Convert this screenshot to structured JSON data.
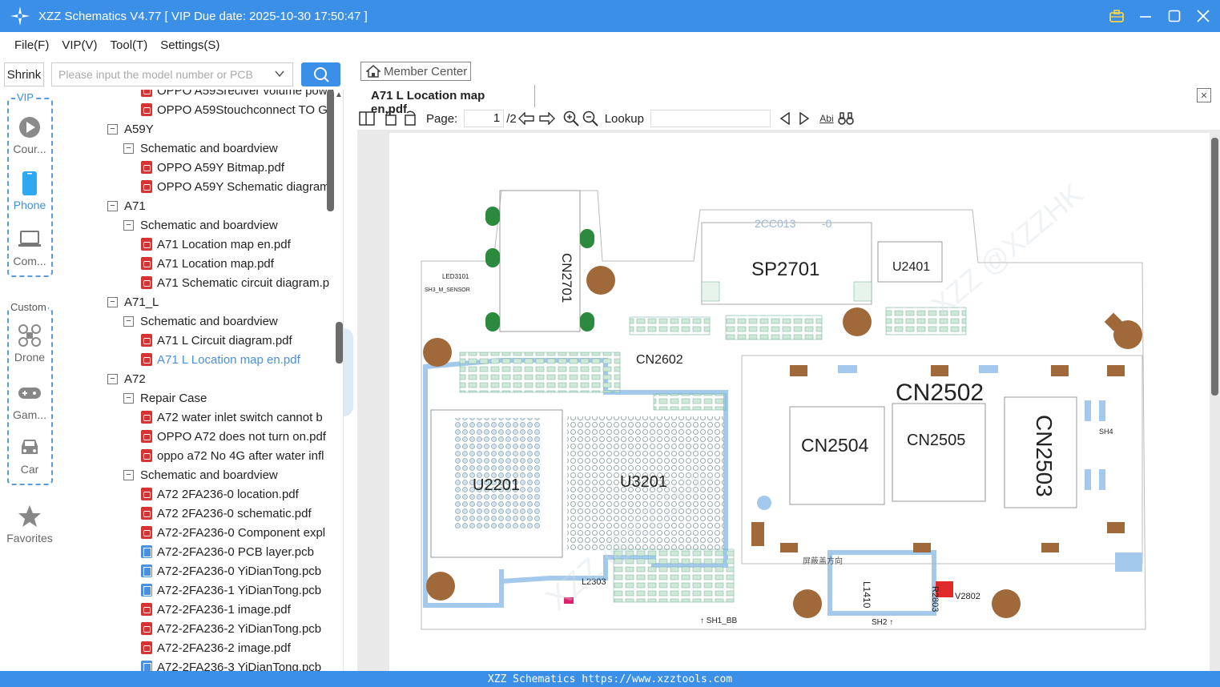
{
  "app": {
    "title": "XZZ Schematics V4.77 [ VIP Due date: 2025-10-30 17:50:47 ]"
  },
  "menu": [
    "File(F)",
    "VIP(V)",
    "Tool(T)",
    "Settings(S)"
  ],
  "search": {
    "shrink_label": "Shrink",
    "placeholder": "Please input the model number or PCB"
  },
  "categories": {
    "vip_label": "VIP",
    "custom_label": "Custom",
    "vip": [
      "Cour...",
      "Phone",
      "Com..."
    ],
    "custom": [
      "Drone",
      "Gam...",
      "Car"
    ],
    "favorites": "Favorites"
  },
  "tree": [
    {
      "level": 3,
      "icon": "pdf",
      "label": "OPPO A59Sreciver volume powe"
    },
    {
      "level": 3,
      "icon": "pdf",
      "label": "OPPO A59Stouchconnect TO GI"
    },
    {
      "level": 1,
      "icon": "box",
      "label": "A59Y"
    },
    {
      "level": 2,
      "icon": "box",
      "label": "Schematic and boardview"
    },
    {
      "level": 3,
      "icon": "pdf",
      "label": "OPPO A59Y Bitmap.pdf"
    },
    {
      "level": 3,
      "icon": "pdf",
      "label": "OPPO A59Y Schematic diagram"
    },
    {
      "level": 1,
      "icon": "box",
      "label": "A71"
    },
    {
      "level": 2,
      "icon": "box",
      "label": "Schematic and boardview"
    },
    {
      "level": 3,
      "icon": "pdf",
      "label": "A71 Location map en.pdf"
    },
    {
      "level": 3,
      "icon": "pdf",
      "label": "A71 Location map.pdf"
    },
    {
      "level": 3,
      "icon": "pdf",
      "label": "A71 Schematic circuit diagram.p"
    },
    {
      "level": 1,
      "icon": "box",
      "label": "A71_L"
    },
    {
      "level": 2,
      "icon": "box",
      "label": "Schematic and boardview"
    },
    {
      "level": 3,
      "icon": "pdf",
      "label": "A71 L Circuit diagram.pdf"
    },
    {
      "level": 3,
      "icon": "pdf",
      "label": "A71 L Location map en.pdf",
      "selected": true
    },
    {
      "level": 1,
      "icon": "box",
      "label": "A72"
    },
    {
      "level": 2,
      "icon": "box",
      "label": "Repair Case"
    },
    {
      "level": 3,
      "icon": "pdf",
      "label": "A72 water inlet switch cannot b"
    },
    {
      "level": 3,
      "icon": "pdf",
      "label": "OPPO A72 does not turn on.pdf"
    },
    {
      "level": 3,
      "icon": "pdf",
      "label": "oppo a72 No 4G after water infl"
    },
    {
      "level": 2,
      "icon": "box",
      "label": "Schematic and boardview"
    },
    {
      "level": 3,
      "icon": "pdf",
      "label": "A72 2FA236-0 location.pdf"
    },
    {
      "level": 3,
      "icon": "pdf",
      "label": "A72 2FA236-0 schematic.pdf"
    },
    {
      "level": 3,
      "icon": "pdf",
      "label": "A72-2FA236-0 Component expl"
    },
    {
      "level": 3,
      "icon": "pcb",
      "label": "A72-2FA236-0 PCB layer.pcb"
    },
    {
      "level": 3,
      "icon": "pcb",
      "label": "A72-2FA236-0 YiDianTong.pcb"
    },
    {
      "level": 3,
      "icon": "pcb",
      "label": "A72-2FA236-1 YiDianTong.pcb"
    },
    {
      "level": 3,
      "icon": "pdf",
      "label": "A72-2FA236-1 image.pdf"
    },
    {
      "level": 3,
      "icon": "pdf",
      "label": "A72-2FA236-2 YiDianTong.pcb"
    },
    {
      "level": 3,
      "icon": "pdf",
      "label": "A72-2FA236-2 image.pdf"
    },
    {
      "level": 3,
      "icon": "pcb",
      "label": "A72-2FA236-3 YiDianTong.pcb"
    }
  ],
  "viewer": {
    "member_center": "Member Center",
    "tab_title": "A71 L Location map en.pdf",
    "page_label": "Page:",
    "page_current": "1",
    "page_total": "/2",
    "lookup_label": "Lookup"
  },
  "board": {
    "labels": [
      "CN2701",
      "SP2701",
      "U2401",
      "2CC013",
      "-0",
      "CN2602",
      "CN2502",
      "CN2504",
      "CN2505",
      "CN2503",
      "U2201",
      "U3201",
      "L2303",
      "L1410",
      "R2803",
      "V2802",
      "SH1_BB",
      "SH2",
      "SH4",
      "LED3101",
      "SH3_M_SENSOR",
      "屏蔽盖方向"
    ],
    "watermark": "XZZ @XZZHK"
  },
  "status": {
    "text": "XZZ Schematics https://www.xzztools.com"
  },
  "colors": {
    "accent": "#3b8fe6",
    "pdf_icon": "#d63333",
    "pcb_icon": "#4a8fe0",
    "selected_text": "#4a8fe0"
  }
}
